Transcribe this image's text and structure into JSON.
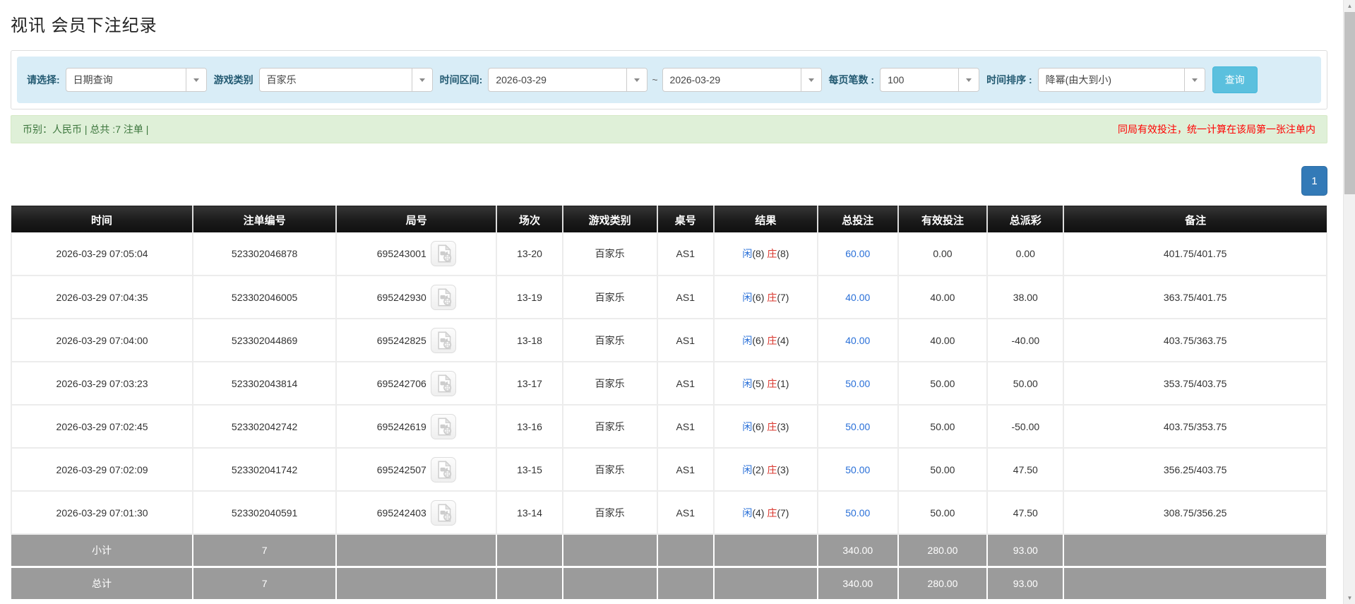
{
  "page": {
    "title": "视讯 会员下注纪录"
  },
  "filters": {
    "select_label": "请选择:",
    "select_value": "日期查询",
    "game_type_label": "游戏类别",
    "game_type_value": "百家乐",
    "time_range_label": "时间区间:",
    "date_from": "2026-03-29",
    "tilde": "~",
    "date_to": "2026-03-29",
    "page_size_label": "每页笔数 :",
    "page_size_value": "100",
    "sort_label": "时间排序 :",
    "sort_value": "降幂(由大到小)",
    "search_button": "查询"
  },
  "summary": {
    "left": "币别：人民币 | 总共 :7 注单 |",
    "right": "同局有效投注，统一计算在该局第一张注单内"
  },
  "pagination": {
    "current": "1"
  },
  "colors": {
    "filter_bar_bg": "#d9edf7",
    "search_button_bg": "#5bc0de",
    "summary_bg": "#dff0d8",
    "summary_text_green": "#3c763d",
    "summary_text_red": "#ff0000",
    "header_bg": "#1a1a1a",
    "link_blue": "#2a70d8",
    "player_blue": "#2a70d8",
    "banker_red": "#d9342b",
    "negative_red": "#e60000",
    "pagination_bg": "#337ab7",
    "total_row_bg": "#9b9b9b"
  },
  "table": {
    "headers": [
      "时间",
      "注单编号",
      "局号",
      "场次",
      "游戏类别",
      "桌号",
      "结果",
      "总投注",
      "有效投注",
      "总派彩",
      "备注"
    ],
    "rows": [
      {
        "time": "2026-03-29 07:05:04",
        "bet_id": "523302046878",
        "round_id": "695243001",
        "session": "13-20",
        "game": "百家乐",
        "table_no": "AS1",
        "result": {
          "player_label": "闲",
          "player_score": "(8)",
          "banker_label": "庄",
          "banker_score": "(8)"
        },
        "total_bet": "60.00",
        "valid_bet": "0.00",
        "payout": "0.00",
        "remark": "401.75/401.75"
      },
      {
        "time": "2026-03-29 07:04:35",
        "bet_id": "523302046005",
        "round_id": "695242930",
        "session": "13-19",
        "game": "百家乐",
        "table_no": "AS1",
        "result": {
          "player_label": "闲",
          "player_score": "(6)",
          "banker_label": "庄",
          "banker_score": "(7)"
        },
        "total_bet": "40.00",
        "valid_bet": "40.00",
        "payout": "38.00",
        "remark": "363.75/401.75"
      },
      {
        "time": "2026-03-29 07:04:00",
        "bet_id": "523302044869",
        "round_id": "695242825",
        "session": "13-18",
        "game": "百家乐",
        "table_no": "AS1",
        "result": {
          "player_label": "闲",
          "player_score": "(6)",
          "banker_label": "庄",
          "banker_score": "(4)"
        },
        "total_bet": "40.00",
        "valid_bet": "40.00",
        "payout": "-40.00",
        "remark": "403.75/363.75"
      },
      {
        "time": "2026-03-29 07:03:23",
        "bet_id": "523302043814",
        "round_id": "695242706",
        "session": "13-17",
        "game": "百家乐",
        "table_no": "AS1",
        "result": {
          "player_label": "闲",
          "player_score": "(5)",
          "banker_label": "庄",
          "banker_score": "(1)"
        },
        "total_bet": "50.00",
        "valid_bet": "50.00",
        "payout": "50.00",
        "remark": "353.75/403.75"
      },
      {
        "time": "2026-03-29 07:02:45",
        "bet_id": "523302042742",
        "round_id": "695242619",
        "session": "13-16",
        "game": "百家乐",
        "table_no": "AS1",
        "result": {
          "player_label": "闲",
          "player_score": "(6)",
          "banker_label": "庄",
          "banker_score": "(3)"
        },
        "total_bet": "50.00",
        "valid_bet": "50.00",
        "payout": "-50.00",
        "remark": "403.75/353.75"
      },
      {
        "time": "2026-03-29 07:02:09",
        "bet_id": "523302041742",
        "round_id": "695242507",
        "session": "13-15",
        "game": "百家乐",
        "table_no": "AS1",
        "result": {
          "player_label": "闲",
          "player_score": "(2)",
          "banker_label": "庄",
          "banker_score": "(3)"
        },
        "total_bet": "50.00",
        "valid_bet": "50.00",
        "payout": "47.50",
        "remark": "356.25/403.75"
      },
      {
        "time": "2026-03-29 07:01:30",
        "bet_id": "523302040591",
        "round_id": "695242403",
        "session": "13-14",
        "game": "百家乐",
        "table_no": "AS1",
        "result": {
          "player_label": "闲",
          "player_score": "(4)",
          "banker_label": "庄",
          "banker_score": "(7)"
        },
        "total_bet": "50.00",
        "valid_bet": "50.00",
        "payout": "47.50",
        "remark": "308.75/356.25"
      }
    ],
    "footer": [
      {
        "label": "小计",
        "count": "7",
        "total_bet": "340.00",
        "valid_bet": "280.00",
        "payout": "93.00"
      },
      {
        "label": "总计",
        "count": "7",
        "total_bet": "340.00",
        "valid_bet": "280.00",
        "payout": "93.00"
      }
    ]
  },
  "scrollbar": {
    "up_arrow": "▲",
    "down_arrow": "▼"
  }
}
